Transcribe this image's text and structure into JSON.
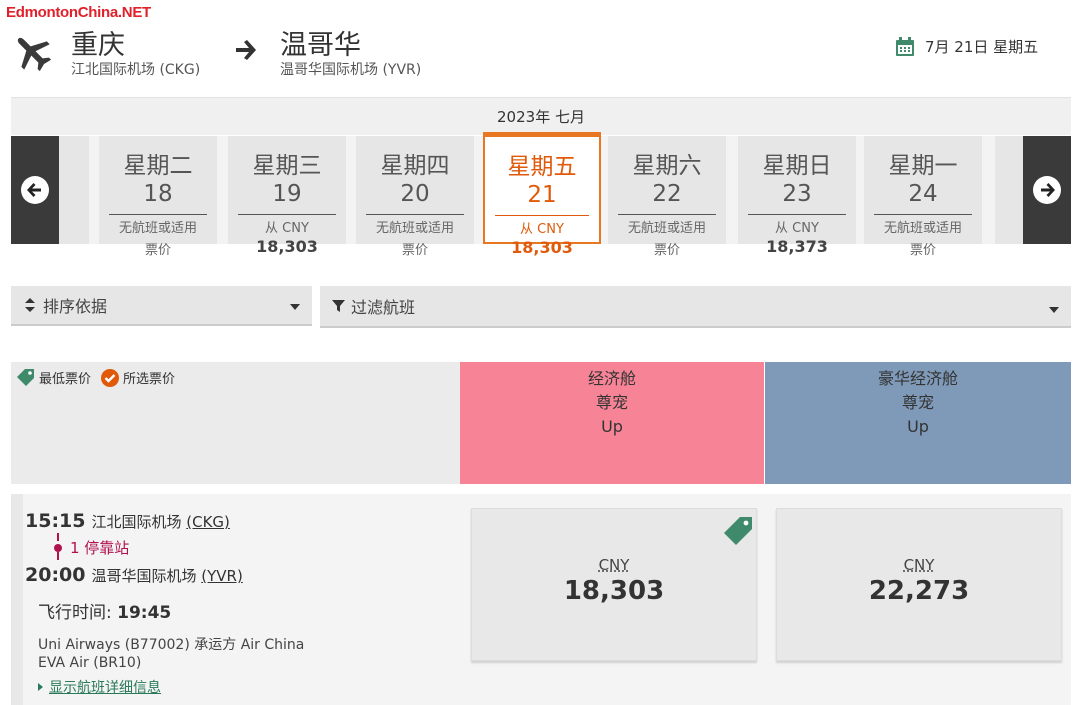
{
  "watermark": "EdmontonChina.NET",
  "route": {
    "origin_city": "重庆",
    "origin_airport": "江北国际机场 (CKG)",
    "dest_city": "温哥华",
    "dest_airport": "温哥华国际机场 (YVR)"
  },
  "selected_date": "7月 21日 星期五",
  "month_label": "2023年 七月",
  "days": [
    {
      "weekday": "星期二 18",
      "line1": "无航班或适用",
      "line2": "票价"
    },
    {
      "weekday": "星期三 19",
      "line1": "从 CNY",
      "line2": "18,303"
    },
    {
      "weekday": "星期四 20",
      "line1": "无航班或适用",
      "line2": "票价"
    },
    {
      "weekday": "星期五 21",
      "line1": "从 CNY",
      "line2": "18,303"
    },
    {
      "weekday": "星期六 22",
      "line1": "无航班或适用",
      "line2": "票价"
    },
    {
      "weekday": "星期日 23",
      "line1": "从 CNY",
      "line2": "18,373"
    },
    {
      "weekday": "星期一 24",
      "line1": "无航班或适用",
      "line2": "票价"
    }
  ],
  "sort_label": "排序依据",
  "filter_label": "过滤航班",
  "legend": {
    "lowest": "最低票价",
    "selected": "所选票价"
  },
  "cabins": [
    {
      "l1": "经济舱",
      "l2": "尊宠",
      "l3": "Up",
      "color": "#f78496"
    },
    {
      "l1": "豪华经济舱",
      "l2": "尊宠",
      "l3": "Up",
      "color": "#7f9ab8"
    }
  ],
  "flight": {
    "dep_time": "15:15",
    "dep_airport": "江北国际机场 ",
    "dep_code": "(CKG)",
    "stops": "1 停靠站",
    "arr_time": "20:00",
    "arr_airport": "温哥华国际机场 ",
    "arr_code": "(YVR)",
    "duration_label": "飞行时间:",
    "duration": "19:45",
    "carrier1": "Uni Airways (B77002) 承运方 Air China",
    "carrier2": "EVA Air (BR10)",
    "details": "显示航班详细信息"
  },
  "prices": [
    {
      "currency": "CNY",
      "amount": "18,303"
    },
    {
      "currency": "CNY",
      "amount": "22,273"
    }
  ],
  "colors": {
    "accent": "#e87722",
    "stops": "#b0124e",
    "icon_green": "#3f8a6a"
  }
}
